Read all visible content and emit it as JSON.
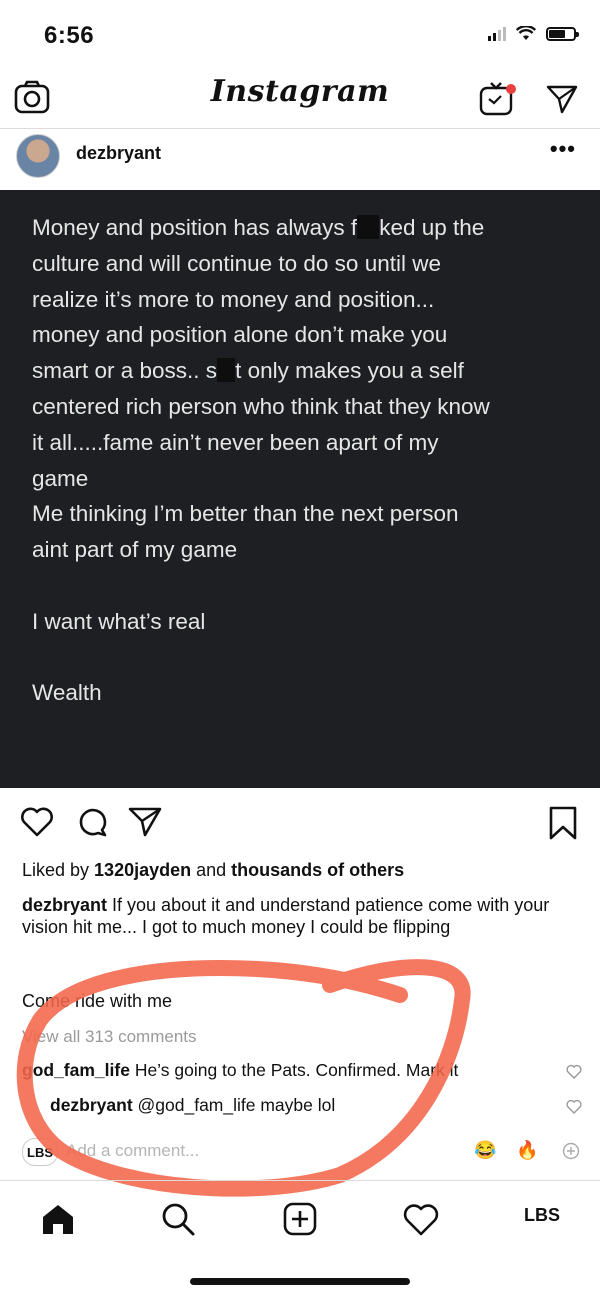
{
  "status_bar": {
    "time": "6:56"
  },
  "header": {
    "logo": "Instagram"
  },
  "post": {
    "username": "dezbryant",
    "more": "•••",
    "image_text": {
      "line1a": "Money and position has always f",
      "line1b": "ked up the",
      "line2": "culture and will continue to do so until we",
      "line3": "realize it’s more to money and position...",
      "line4": "money and position alone don’t make you",
      "line5a": "smart or a boss.. s",
      "line5b": "t only makes you a self",
      "line6": "centered rich person who think that they know",
      "line7": "it all.....fame ain’t never been apart of my",
      "line8": "game",
      "line9": "Me thinking I’m better than the next person",
      "line10": "aint part of my game",
      "line11": "I want what’s real",
      "line12": "Wealth"
    },
    "likes": {
      "prefix": "Liked by ",
      "user": "1320jayden",
      "middle": " and ",
      "rest": "thousands of others"
    },
    "caption": {
      "username": "dezbryant",
      "text": " If you about it and understand patience come with your vision hit me... I got to much money I could be flipping",
      "text2": "Come ride with me"
    },
    "view_all": "View all 313 comments",
    "comments": [
      {
        "username": "god_fam_life",
        "text": " He’s going to the Pats. Confirmed. Mark it"
      },
      {
        "username": "dezbryant",
        "text": " @god_fam_life maybe lol"
      }
    ],
    "add_comment": {
      "avatar_label": "LBS",
      "placeholder": "Add a comment...",
      "emoji1": "😂",
      "emoji2": "🔥"
    }
  },
  "tab_bar": {
    "profile_label": "LBS"
  },
  "colors": {
    "post_bg": "#1e1f22",
    "annotation": "#f2674a"
  }
}
